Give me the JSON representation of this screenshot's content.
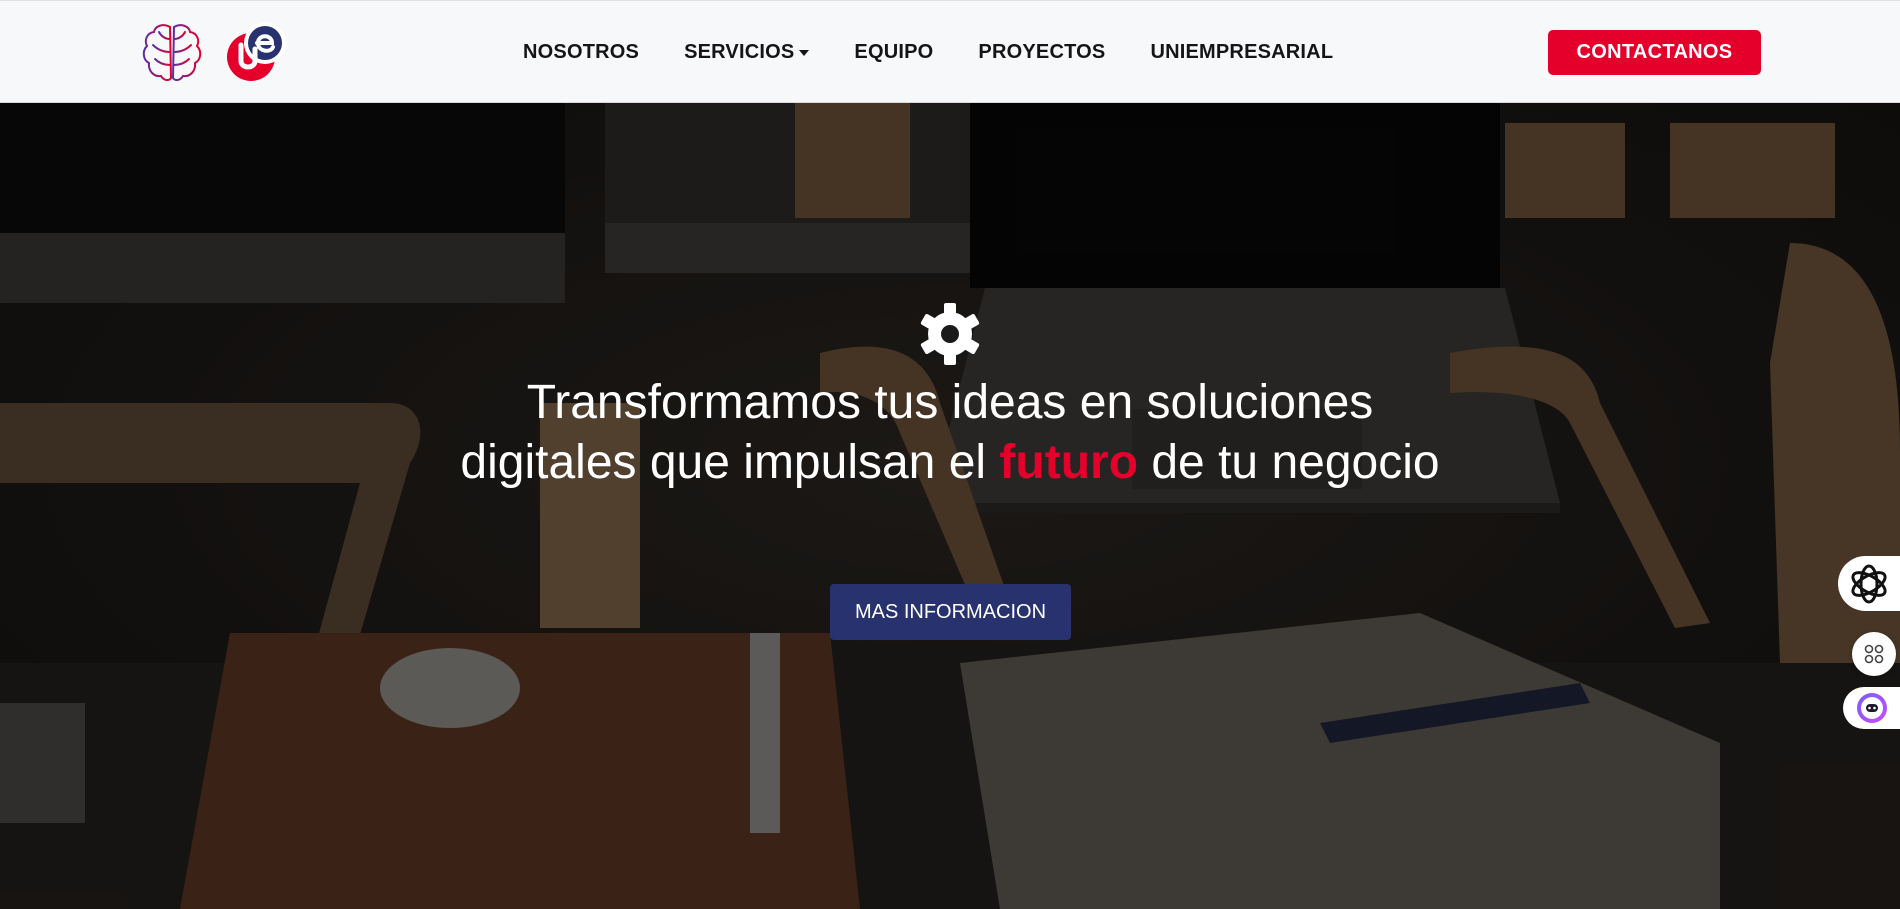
{
  "navbar": {
    "logos": [
      "brain-logo",
      "ue-logo"
    ],
    "links": [
      {
        "label": "NOSOTROS"
      },
      {
        "label": "SERVICIOS",
        "has_dropdown": true
      },
      {
        "label": "EQUIPO"
      },
      {
        "label": "PROYECTOS"
      },
      {
        "label": "UNIEMPRESARIAL"
      }
    ],
    "contact_label": "CONTACTANOS"
  },
  "hero": {
    "icon": "gear-icon",
    "title_part1": "Transformamos tus ideas en soluciones digitales que impulsan el ",
    "title_highlight": "futuro",
    "title_part2": " de tu negocio",
    "button_label": "MAS INFORMACION"
  },
  "side_widgets": [
    "openai-icon",
    "apps-grid-icon",
    "bot-face-icon"
  ],
  "colors": {
    "accent_red": "#e4002b",
    "button_navy": "#27326e",
    "navbar_bg": "#f7f8fa",
    "brain_gradient_start": "#5a2ea6",
    "brain_gradient_end": "#e4002b"
  }
}
